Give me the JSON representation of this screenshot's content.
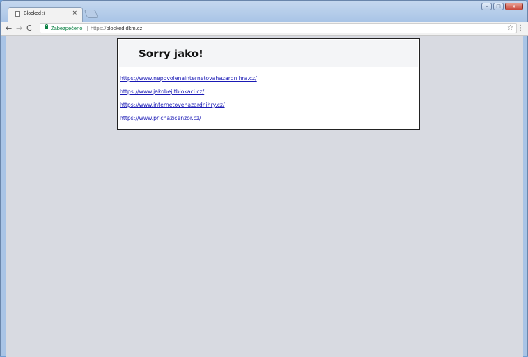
{
  "tab": {
    "title": "Blocked :(",
    "close": "×"
  },
  "toolbar": {
    "back": "←",
    "forward": "→",
    "reload": "C",
    "secure_label": "Zabezpečeno",
    "url_scheme": "https://",
    "url_host": "blocked.dkm.cz",
    "star": "☆",
    "menu": "⋮"
  },
  "window_controls": {
    "minimize": "–",
    "maximize": "□",
    "close": "x"
  },
  "page": {
    "heading": "Sorry jako!",
    "links": [
      "https://www.nepovolenainternetovahazardnihra.cz/",
      "https://www.jakobejitblokaci.cz/",
      "https://www.internetovehazardnihry.cz/",
      "https://www.prichazicenzor.cz/"
    ]
  }
}
